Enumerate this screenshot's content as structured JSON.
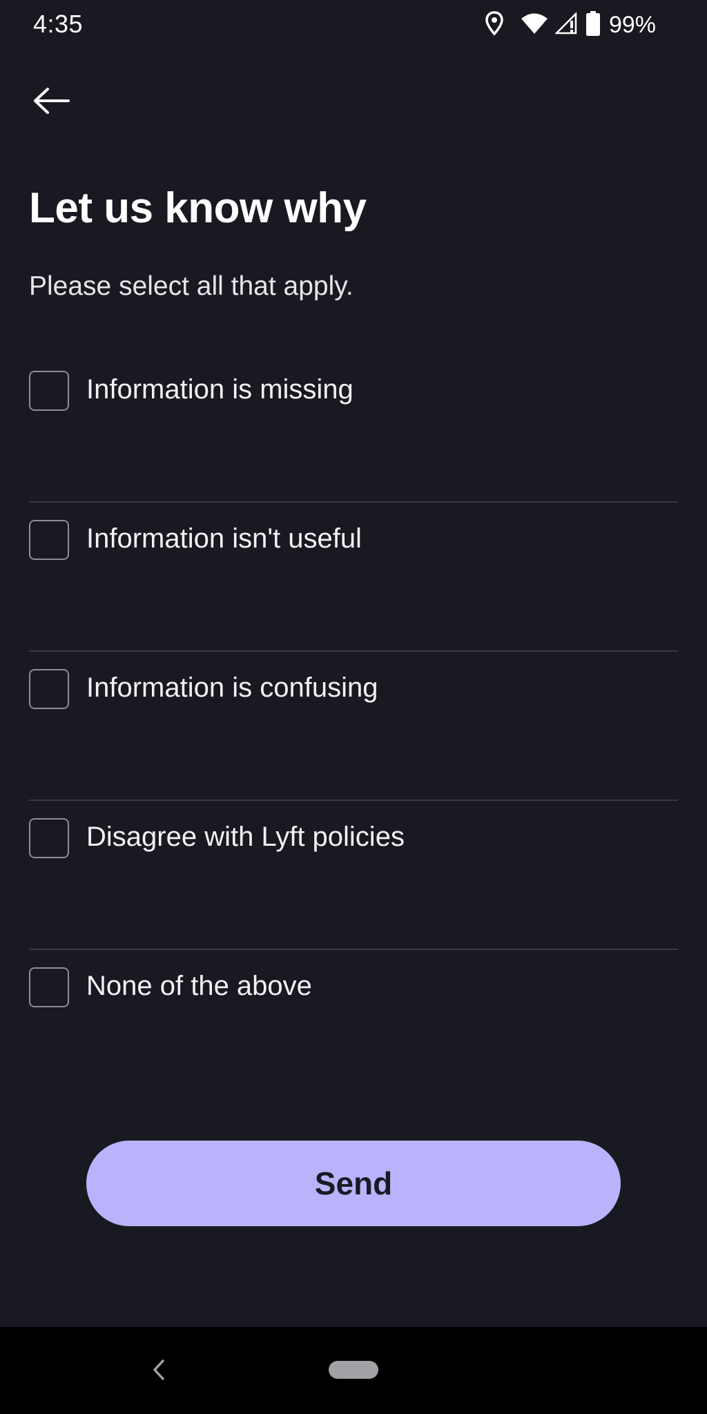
{
  "status_bar": {
    "time": "4:35",
    "battery_percent": "99%",
    "icons": [
      "location-icon",
      "wifi-icon",
      "signal-icon",
      "battery-icon"
    ]
  },
  "header": {
    "back_icon": "arrow-left-icon"
  },
  "main": {
    "title": "Let us know why",
    "subtitle": "Please select all that apply.",
    "options": [
      {
        "label": "Information is missing",
        "checked": false
      },
      {
        "label": "Information isn't useful",
        "checked": false
      },
      {
        "label": "Information is confusing",
        "checked": false
      },
      {
        "label": "Disagree with Lyft policies",
        "checked": false
      },
      {
        "label": "None of the above",
        "checked": false
      }
    ],
    "send_label": "Send"
  },
  "nav_bar": {
    "back_icon": "chevron-left-icon",
    "home_icon": "home-pill-icon"
  },
  "colors": {
    "background": "#191a21",
    "accent": "#bab3fb",
    "divider": "#3a3b42",
    "nav_background": "#000000"
  }
}
